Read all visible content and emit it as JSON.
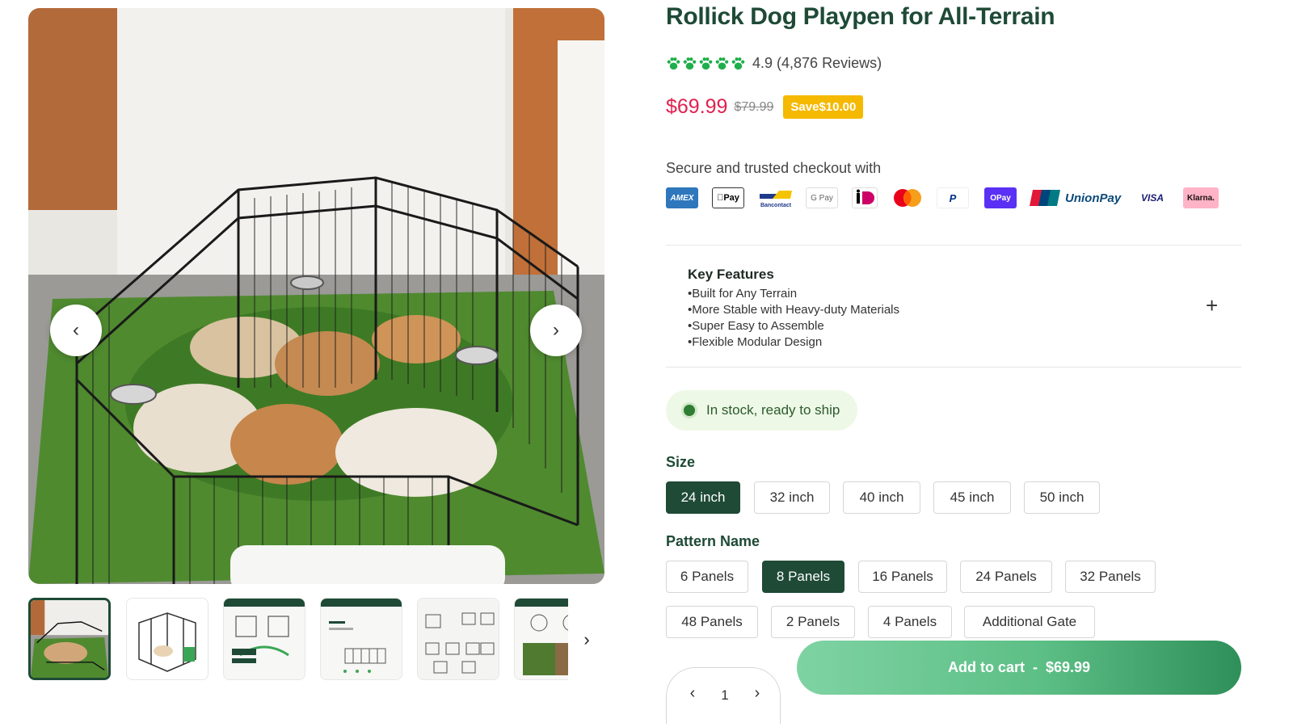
{
  "product": {
    "title": "Rollick Dog Playpen for All-Terrain",
    "rating_text": "4.9 (4,876 Reviews)",
    "rating_value": 4.9,
    "price": "$69.99",
    "old_price": "$79.99",
    "save_badge": "Save$10.00"
  },
  "gallery": {
    "prev_icon": "‹",
    "next_icon": "›",
    "thumbs_next_icon": "›",
    "thumb_count_visible": 6
  },
  "checkout": {
    "label": "Secure and trusted checkout with",
    "payment_methods": [
      "AMEX",
      "Pay",
      "Bancontact",
      "G Pay",
      "iDEAL",
      "Mastercard",
      "PayPal",
      "OPay",
      "UnionPay",
      "VISA",
      "Klarna."
    ]
  },
  "features": {
    "title": "Key Features",
    "items": [
      "•Built for Any Terrain",
      "•More Stable with Heavy-duty Materials",
      "•Super Easy to Assemble",
      "•Flexible Modular Design"
    ],
    "expand_icon": "+"
  },
  "stock": {
    "text": "In stock, ready to ship"
  },
  "size": {
    "label": "Size",
    "options": [
      "24 inch",
      "32 inch",
      "40 inch",
      "45 inch",
      "50 inch"
    ],
    "selected": "24 inch"
  },
  "pattern": {
    "label": "Pattern Name",
    "options": [
      "6 Panels",
      "8 Panels",
      "16 Panels",
      "24 Panels",
      "32 Panels",
      "48 Panels",
      "2 Panels",
      "4 Panels",
      "Additional Gate"
    ],
    "selected": "8 Panels"
  },
  "quantity": {
    "value": "1",
    "dec_icon": "‹",
    "inc_icon": "›"
  },
  "cart": {
    "label": "Add to cart",
    "separator": "-",
    "price": "$69.99"
  },
  "colors": {
    "brand": "#1e4a36",
    "price": "#e0214f",
    "badge": "#f5b900",
    "stock_bg": "#eef8e6"
  }
}
